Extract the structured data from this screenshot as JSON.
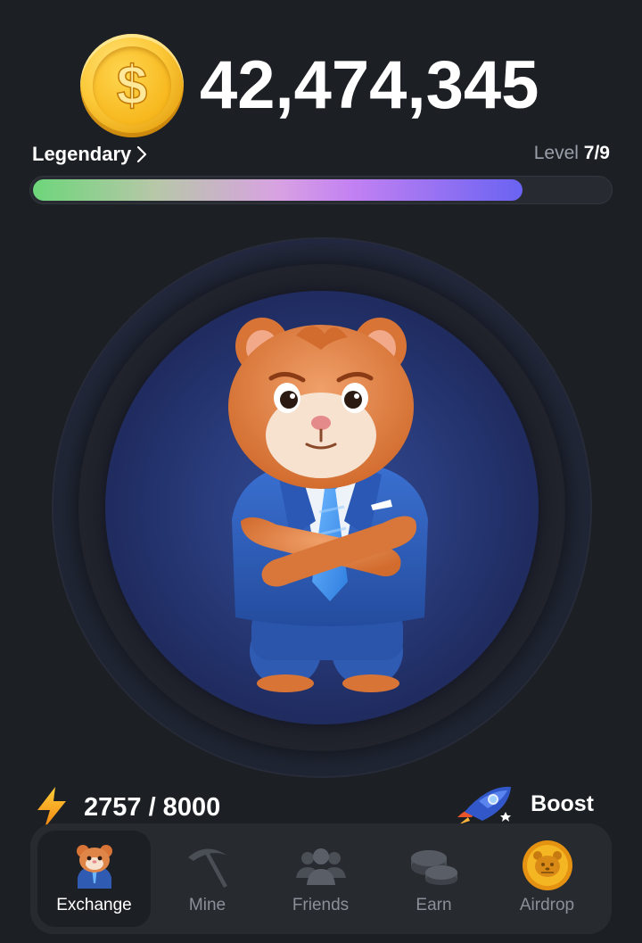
{
  "balance": {
    "value": "42,474,345",
    "currency_symbol": "$",
    "coin_icon": "dollar-coin-icon"
  },
  "rank": {
    "label": "Legendary",
    "chevron": "›"
  },
  "level": {
    "prefix": "Level",
    "value": "7/9",
    "progress": 0.85
  },
  "character": {
    "name": "hamster-ceo",
    "icon": "hamster-character-icon"
  },
  "energy": {
    "value": "2757 / 8000",
    "icon": "lightning-icon"
  },
  "boost": {
    "label": "Boost",
    "icon": "rocket-icon"
  },
  "nav": {
    "items": [
      {
        "label": "Exchange",
        "icon": "hamster-icon",
        "active": true
      },
      {
        "label": "Mine",
        "icon": "pickaxe-icon",
        "active": false
      },
      {
        "label": "Friends",
        "icon": "friends-icon",
        "active": false
      },
      {
        "label": "Earn",
        "icon": "coins-icon",
        "active": false
      },
      {
        "label": "Airdrop",
        "icon": "hamster-coin-icon",
        "active": false
      }
    ]
  },
  "colors": {
    "background": "#1c1f24",
    "accent_blue": "#4a52ee",
    "coin_gold": "#f7b81e",
    "energy_orange": "#f7a21b",
    "nav_background": "#272a2f"
  }
}
